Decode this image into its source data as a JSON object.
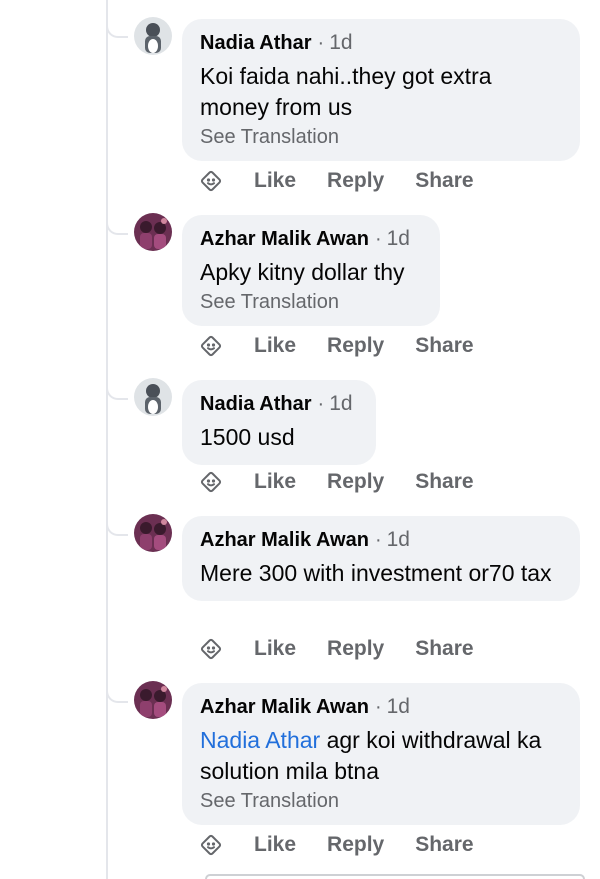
{
  "comments": [
    {
      "author": "Nadia Athar",
      "time": "1d",
      "text": "Koi faida nahi..they got extra money from us",
      "see_translation": "See Translation",
      "avatar": "nadia-avatar"
    },
    {
      "author": "Azhar Malik Awan",
      "time": "1d",
      "text": "Apky kitny dollar thy",
      "see_translation": "See Translation",
      "avatar": "azhar-avatar"
    },
    {
      "author": "Nadia Athar",
      "time": "1d",
      "text": "1500 usd",
      "avatar": "nadia-avatar"
    },
    {
      "author": "Azhar Malik Awan",
      "time": "1d",
      "text": "Mere 300 with investment or70 tax",
      "avatar": "azhar-avatar"
    },
    {
      "author": "Azhar Malik Awan",
      "time": "1d",
      "mention": "Nadia Athar",
      "text": " agr koi withdrawal ka solution mila btna",
      "see_translation": "See Translation",
      "avatar": "azhar-avatar"
    }
  ],
  "actions": {
    "like": "Like",
    "reply": "Reply",
    "share": "Share",
    "react_icon": "react-emoji-icon"
  },
  "separator": "·",
  "colors": {
    "bubble": "#f0f2f5",
    "secondary_text": "#65676b",
    "mention": "#216fdb",
    "thread_line": "#e4e6eb"
  }
}
